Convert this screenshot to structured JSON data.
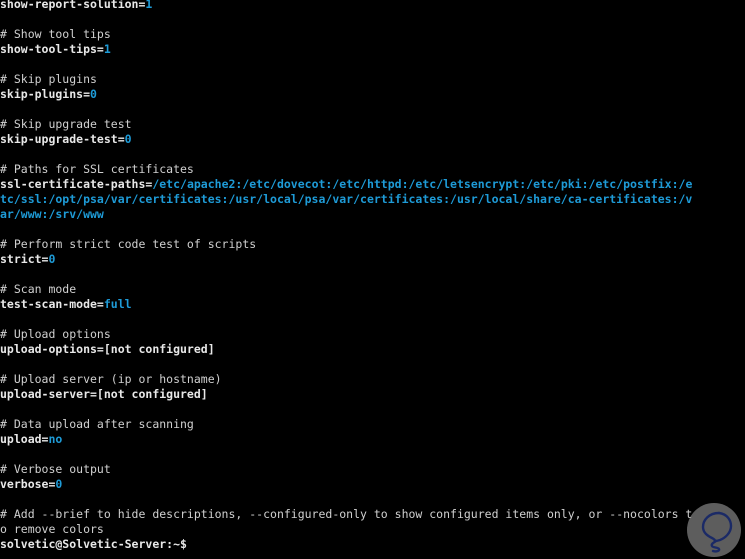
{
  "terminal": {
    "window_title": "solvetic@Solvetic-Server: ~",
    "background_color": "#000000",
    "foreground_color": "#e8e8e8",
    "value_color": "#1e9bd7",
    "comment_color": "#d0d0d0",
    "columns": 100,
    "rows": 37,
    "prompt": "solvetic@Solvetic-Server:~$",
    "lines": [
      {
        "type": "setting",
        "key": "show-report-solution=",
        "value": "1"
      },
      {
        "type": "blank",
        "text": ""
      },
      {
        "type": "comment",
        "text": "# Show tool tips"
      },
      {
        "type": "setting",
        "key": "show-tool-tips=",
        "value": "1"
      },
      {
        "type": "blank",
        "text": ""
      },
      {
        "type": "comment",
        "text": "# Skip plugins"
      },
      {
        "type": "setting",
        "key": "skip-plugins=",
        "value": "0"
      },
      {
        "type": "blank",
        "text": ""
      },
      {
        "type": "comment",
        "text": "# Skip upgrade test"
      },
      {
        "type": "setting",
        "key": "skip-upgrade-test=",
        "value": "0"
      },
      {
        "type": "blank",
        "text": ""
      },
      {
        "type": "comment",
        "text": "# Paths for SSL certificates"
      },
      {
        "type": "setting",
        "key": "ssl-certificate-paths=",
        "value": "/etc/apache2:/etc/dovecot:/etc/httpd:/etc/letsencrypt:/etc/pki:/etc/postfix:/e"
      },
      {
        "type": "value-cont",
        "value": "tc/ssl:/opt/psa/var/certificates:/usr/local/psa/var/certificates:/usr/local/share/ca-certificates:/v"
      },
      {
        "type": "value-cont",
        "value": "ar/www:/srv/www"
      },
      {
        "type": "blank",
        "text": ""
      },
      {
        "type": "comment",
        "text": "# Perform strict code test of scripts"
      },
      {
        "type": "setting",
        "key": "strict=",
        "value": "0"
      },
      {
        "type": "blank",
        "text": ""
      },
      {
        "type": "comment",
        "text": "# Scan mode"
      },
      {
        "type": "setting",
        "key": "test-scan-mode=",
        "value": "full"
      },
      {
        "type": "blank",
        "text": ""
      },
      {
        "type": "comment",
        "text": "# Upload options"
      },
      {
        "type": "plain",
        "text": "upload-options=[not configured]"
      },
      {
        "type": "blank",
        "text": ""
      },
      {
        "type": "comment",
        "text": "# Upload server (ip or hostname)"
      },
      {
        "type": "plain",
        "text": "upload-server=[not configured]"
      },
      {
        "type": "blank",
        "text": ""
      },
      {
        "type": "comment",
        "text": "# Data upload after scanning"
      },
      {
        "type": "setting",
        "key": "upload=",
        "value": "no"
      },
      {
        "type": "blank",
        "text": ""
      },
      {
        "type": "comment",
        "text": "# Verbose output"
      },
      {
        "type": "setting",
        "key": "verbose=",
        "value": "0"
      },
      {
        "type": "blank",
        "text": ""
      },
      {
        "type": "comment",
        "text": "# Add --brief to hide descriptions, --configured-only to show configured items only, or --nocolors t"
      },
      {
        "type": "comment",
        "text": "o remove colors"
      },
      {
        "type": "prompt",
        "text": "solvetic@Solvetic-Server:~$"
      }
    ]
  },
  "watermark": {
    "name": "solvetic-logo-watermark",
    "disc_color": "#969696",
    "glyph_color": "#1b2a66"
  }
}
